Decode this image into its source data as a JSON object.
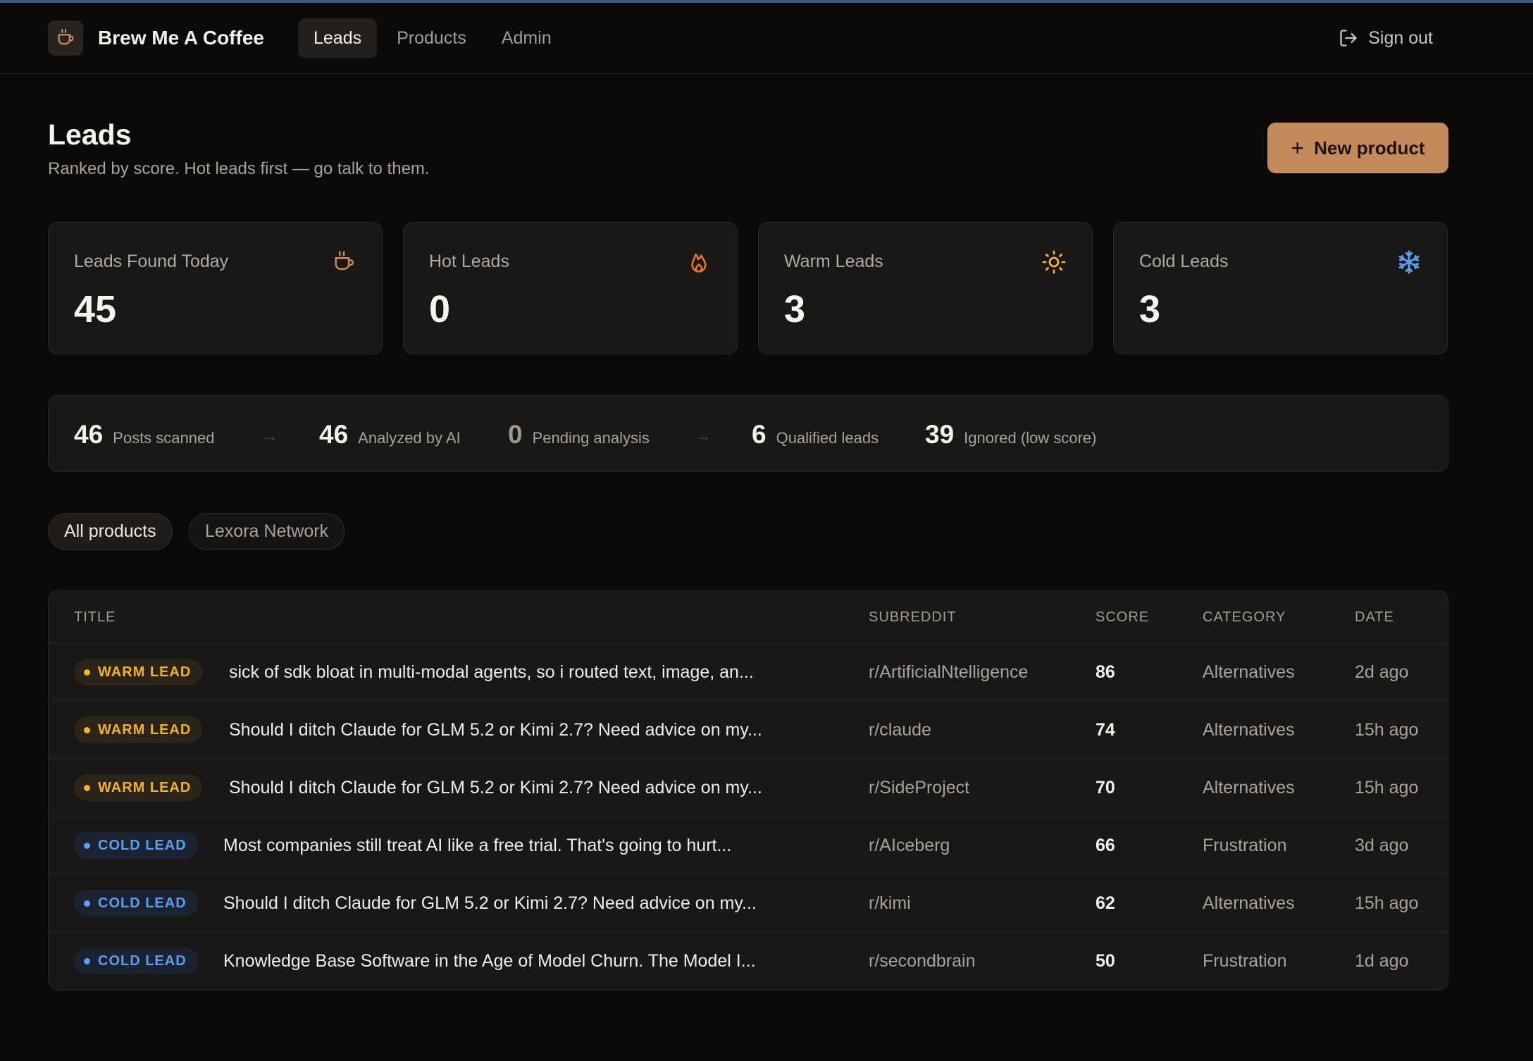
{
  "app": {
    "name": "Brew Me A Coffee"
  },
  "nav": {
    "tabs": [
      {
        "label": "Leads",
        "active": true
      },
      {
        "label": "Products",
        "active": false
      },
      {
        "label": "Admin",
        "active": false
      }
    ],
    "sign_out": "Sign out"
  },
  "page": {
    "title": "Leads",
    "subtitle": "Ranked by score. Hot leads first — go talk to them.",
    "new_button": "New product"
  },
  "stats": [
    {
      "label": "Leads Found Today",
      "value": "45",
      "icon": "coffee-cup-icon",
      "color": "#c38a5c"
    },
    {
      "label": "Hot Leads",
      "value": "0",
      "icon": "flame-icon",
      "color": "#e8792a"
    },
    {
      "label": "Warm Leads",
      "value": "3",
      "icon": "sun-icon",
      "color": "#f0b429"
    },
    {
      "label": "Cold Leads",
      "value": "3",
      "icon": "snowflake-icon",
      "color": "#5b9ef0"
    }
  ],
  "pipeline": [
    {
      "value": "46",
      "label": "Posts scanned"
    },
    {
      "value": "46",
      "label": "Analyzed by AI"
    },
    {
      "value": "0",
      "label": "Pending analysis"
    },
    {
      "value": "6",
      "label": "Qualified leads"
    },
    {
      "value": "39",
      "label": "Ignored (low score)"
    }
  ],
  "filters": [
    {
      "label": "All products",
      "active": true
    },
    {
      "label": "Lexora Network",
      "active": false
    }
  ],
  "table": {
    "headers": {
      "title": "TITLE",
      "subreddit": "SUBREDDIT",
      "score": "SCORE",
      "category": "CATEGORY",
      "date": "DATE"
    },
    "rows": [
      {
        "badge": "WARM LEAD",
        "type": "warm",
        "title": "sick of sdk bloat in multi-modal agents, so i routed text, image, an...",
        "subreddit": "r/ArtificialNtelligence",
        "score": "86",
        "category": "Alternatives",
        "date": "2d ago"
      },
      {
        "badge": "WARM LEAD",
        "type": "warm",
        "title": "Should I ditch Claude for GLM 5.2 or Kimi 2.7? Need advice on my...",
        "subreddit": "r/claude",
        "score": "74",
        "category": "Alternatives",
        "date": "15h ago"
      },
      {
        "badge": "WARM LEAD",
        "type": "warm",
        "title": "Should I ditch Claude for GLM 5.2 or Kimi 2.7? Need advice on my...",
        "subreddit": "r/SideProject",
        "score": "70",
        "category": "Alternatives",
        "date": "15h ago"
      },
      {
        "badge": "COLD LEAD",
        "type": "cold",
        "title": "Most companies still treat AI like a free trial. That's going to hurt...",
        "subreddit": "r/AIceberg",
        "score": "66",
        "category": "Frustration",
        "date": "3d ago"
      },
      {
        "badge": "COLD LEAD",
        "type": "cold",
        "title": "Should I ditch Claude for GLM 5.2 or Kimi 2.7? Need advice on my...",
        "subreddit": "r/kimi",
        "score": "62",
        "category": "Alternatives",
        "date": "15h ago"
      },
      {
        "badge": "COLD LEAD",
        "type": "cold",
        "title": "Knowledge Base Software in the Age of Model Churn. The Model I...",
        "subreddit": "r/secondbrain",
        "score": "50",
        "category": "Frustration",
        "date": "1d ago"
      }
    ]
  }
}
